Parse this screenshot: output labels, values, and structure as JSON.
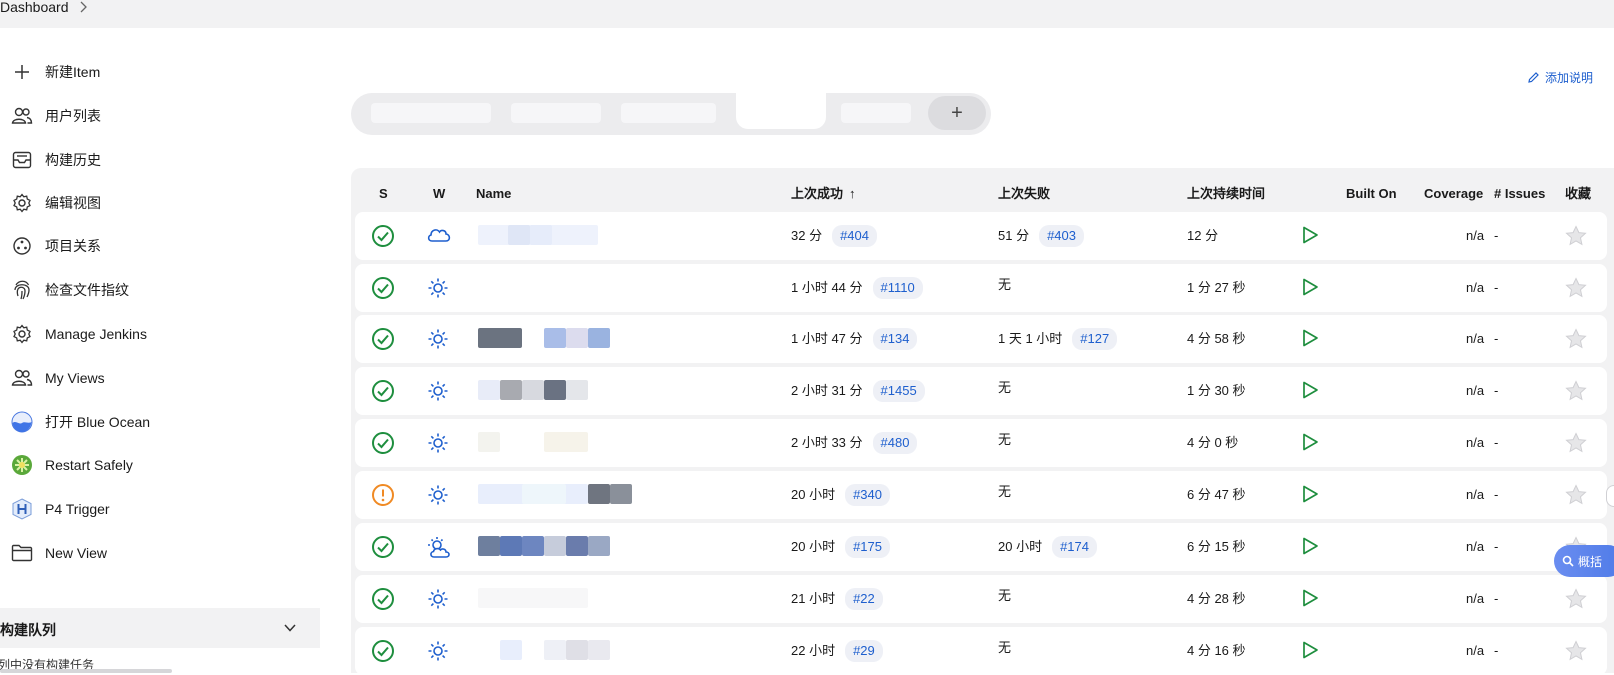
{
  "breadcrumb": {
    "root": "Dashboard"
  },
  "sidebar": {
    "items": [
      {
        "label": "新建Item",
        "icon": "plus-icon"
      },
      {
        "label": "用户列表",
        "icon": "users-icon"
      },
      {
        "label": "构建历史",
        "icon": "inbox-icon"
      },
      {
        "label": "编辑视图",
        "icon": "gear-icon"
      },
      {
        "label": "项目关系",
        "icon": "relations-icon"
      },
      {
        "label": "检查文件指纹",
        "icon": "fingerprint-icon"
      },
      {
        "label": "Manage Jenkins",
        "icon": "gear-icon"
      },
      {
        "label": "My Views",
        "icon": "users-icon"
      },
      {
        "label": "打开 Blue Ocean",
        "icon": "blue-ocean-icon"
      },
      {
        "label": "Restart Safely",
        "icon": "restart-icon"
      },
      {
        "label": "P4 Trigger",
        "icon": "p4-icon"
      },
      {
        "label": "New View",
        "icon": "folder-icon"
      }
    ],
    "build_queue": {
      "title": "构建队列",
      "empty_text": "队列中没有构建任务"
    }
  },
  "main": {
    "add_description": "添加说明",
    "add_tab_symbol": "+"
  },
  "table": {
    "columns": {
      "status": "S",
      "weather": "W",
      "name": "Name",
      "last_success": "上次成功",
      "sort_indicator": "↑",
      "last_failure": "上次失败",
      "last_duration": "上次持续时间",
      "built_on": "Built On",
      "coverage": "Coverage",
      "issues": "# Issues",
      "favorite": "收藏"
    },
    "rows": [
      {
        "status": "success",
        "weather": "cloudy",
        "last_success": "32 分",
        "success_build": "#404",
        "last_failure": "51 分",
        "failure_build": "#403",
        "duration": "12 分",
        "coverage": "n/a",
        "issues": "-"
      },
      {
        "status": "success",
        "weather": "sunny",
        "last_success": "1 小时 44 分",
        "success_build": "#1110",
        "last_failure": "无",
        "failure_build": "",
        "duration": "1 分 27 秒",
        "coverage": "n/a",
        "issues": "-"
      },
      {
        "status": "success",
        "weather": "sunny",
        "last_success": "1 小时 47 分",
        "success_build": "#134",
        "last_failure": "1 天 1 小时",
        "failure_build": "#127",
        "duration": "4 分 58 秒",
        "coverage": "n/a",
        "issues": "-"
      },
      {
        "status": "success",
        "weather": "sunny",
        "last_success": "2 小时 31 分",
        "success_build": "#1455",
        "last_failure": "无",
        "failure_build": "",
        "duration": "1 分 30 秒",
        "coverage": "n/a",
        "issues": "-"
      },
      {
        "status": "success",
        "weather": "sunny",
        "last_success": "2 小时 33 分",
        "success_build": "#480",
        "last_failure": "无",
        "failure_build": "",
        "duration": "4 分 0 秒",
        "coverage": "n/a",
        "issues": "-"
      },
      {
        "status": "unstable",
        "weather": "sunny",
        "last_success": "20 小时",
        "success_build": "#340",
        "last_failure": "无",
        "failure_build": "",
        "duration": "6 分 47 秒",
        "coverage": "n/a",
        "issues": "-"
      },
      {
        "status": "success",
        "weather": "partly-cloudy",
        "last_success": "20 小时",
        "success_build": "#175",
        "last_failure": "20 小时",
        "failure_build": "#174",
        "duration": "6 分 15 秒",
        "coverage": "n/a",
        "issues": "-"
      },
      {
        "status": "success",
        "weather": "sunny",
        "last_success": "21 小时",
        "success_build": "#22",
        "last_failure": "无",
        "failure_build": "",
        "duration": "4 分 28 秒",
        "coverage": "n/a",
        "issues": "-"
      },
      {
        "status": "success",
        "weather": "sunny",
        "last_success": "22 小时",
        "success_build": "#29",
        "last_failure": "无",
        "failure_build": "",
        "duration": "4 分 16 秒",
        "coverage": "n/a",
        "issues": "-"
      }
    ]
  },
  "floating": {
    "summarize_label": "概括"
  },
  "colors": {
    "link": "#1e5fce",
    "success": "#1e8e3e",
    "unstable": "#f08a24",
    "weather": "#1e5fce",
    "run": "#1e8e3e"
  }
}
